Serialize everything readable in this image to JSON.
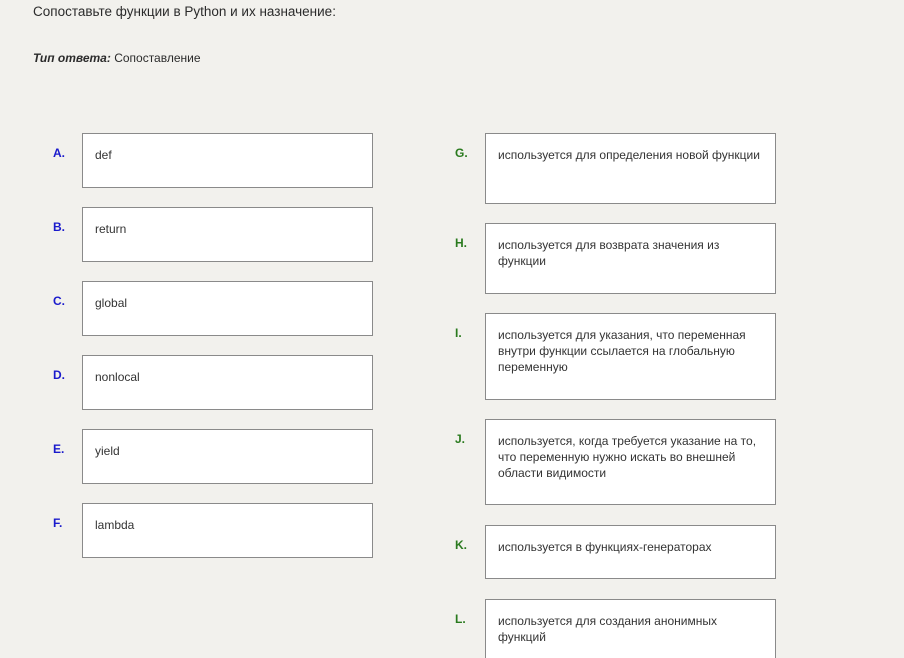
{
  "question": "Сопоставьте функции в Python и их назначение:",
  "answer_type": {
    "label": "Тип ответа:",
    "value": "Сопоставление"
  },
  "left_items": [
    {
      "letter": "A.",
      "text": "def"
    },
    {
      "letter": "B.",
      "text": "return"
    },
    {
      "letter": "C.",
      "text": "global"
    },
    {
      "letter": "D.",
      "text": "nonlocal"
    },
    {
      "letter": "E.",
      "text": "yield"
    },
    {
      "letter": "F.",
      "text": "lambda"
    }
  ],
  "right_items": [
    {
      "letter": "G.",
      "text": "используется для определения новой функции"
    },
    {
      "letter": "H.",
      "text": "используется для возврата значения из функции"
    },
    {
      "letter": "I.",
      "text": "используется для указания, что переменная внутри функции ссылается на глобальную переменную"
    },
    {
      "letter": "J.",
      "text": "используется, когда требуется указание на то, что переменную нужно искать во внешней области видимости"
    },
    {
      "letter": "K.",
      "text": "используется в функциях-генераторах"
    },
    {
      "letter": "L.",
      "text": "используется для создания анонимных функций"
    }
  ],
  "colors": {
    "left_letter": "#1a1acc",
    "right_letter": "#2a7a1e",
    "background": "#f2f1ed"
  }
}
